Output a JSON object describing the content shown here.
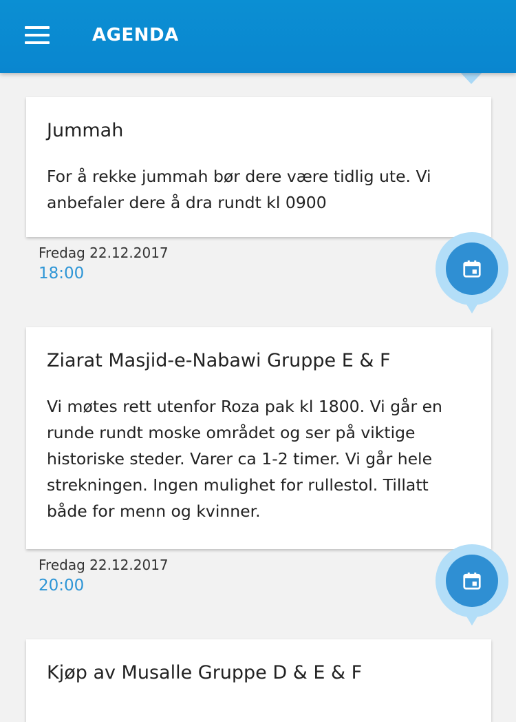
{
  "appbar": {
    "title": "AGENDA"
  },
  "events": [
    {
      "title": "Jummah",
      "body": "For å rekke jummah bør dere være tidlig ute. Vi anbefaler dere å dra rundt kl 0900",
      "date": "Fredag 22.12.2017",
      "time": "18:00"
    },
    {
      "title": "Ziarat Masjid-e-Nabawi Gruppe E & F",
      "body": "Vi møtes rett utenfor Roza pak kl 1800. Vi går en runde rundt moske området og ser på viktige historiske steder. Varer ca 1-2 timer. Vi går hele strekningen. Ingen mulighet for rullestol. Tillatt både for menn og kvinner.",
      "date": "Fredag 22.12.2017",
      "time": "20:00"
    },
    {
      "title": "Kjøp av Musalle Gruppe D & E & F"
    }
  ],
  "icons": {
    "menu": "hamburger-menu-icon",
    "event": "calendar-event-icon"
  },
  "colors": {
    "appbar": "#0b8fd3",
    "accent": "#2d95d6",
    "marker": "#2f8fd3",
    "marker_halo": "#b3def8"
  }
}
